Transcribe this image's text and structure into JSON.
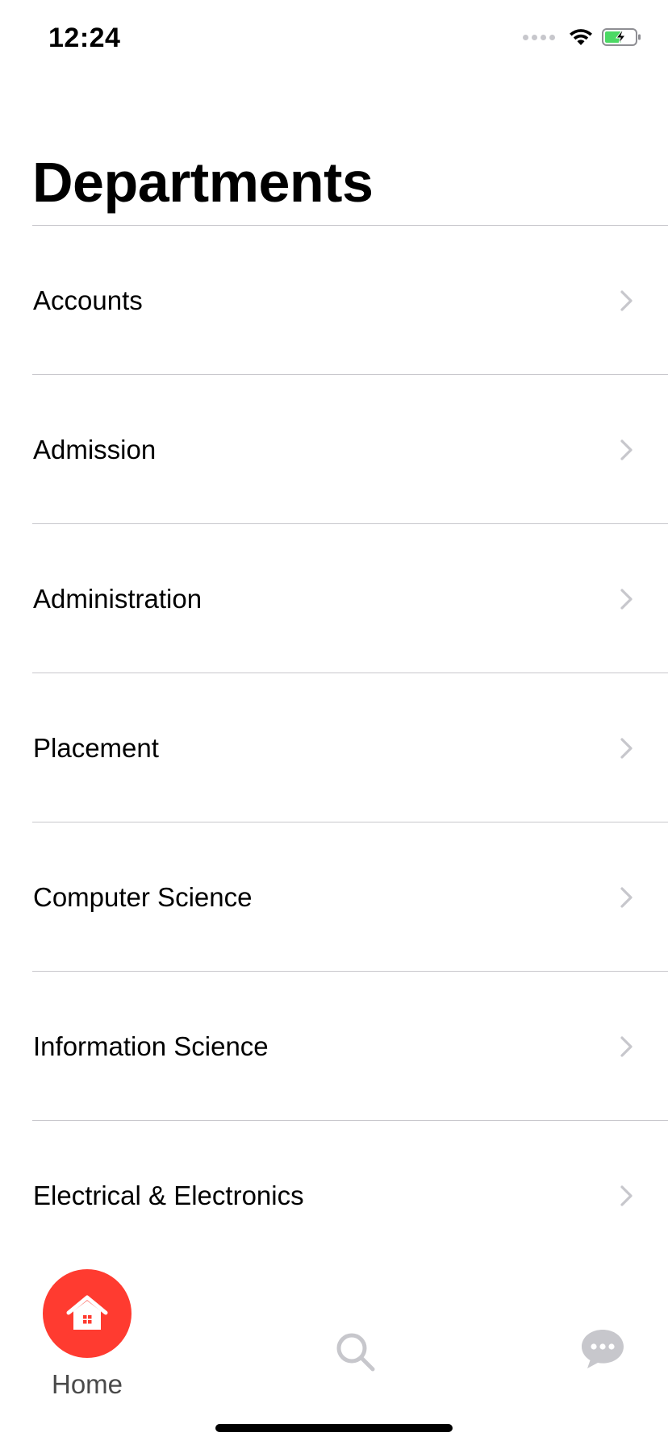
{
  "status_bar": {
    "time": "12:24"
  },
  "header": {
    "title": "Departments"
  },
  "departments": [
    {
      "label": "Accounts"
    },
    {
      "label": "Admission"
    },
    {
      "label": "Administration"
    },
    {
      "label": "Placement"
    },
    {
      "label": "Computer Science"
    },
    {
      "label": "Information Science"
    },
    {
      "label": "Electrical & Electronics"
    }
  ],
  "tab_bar": {
    "home_label": "Home",
    "home_icon": "home-icon",
    "search_icon": "search-icon",
    "chat_icon": "chat-bubble-icon",
    "accent_color": "#ff3b30",
    "inactive_color": "#c7c7cc"
  },
  "colors": {
    "battery_fill": "#4cd964",
    "divider": "#c8c7cc",
    "chevron": "#c7c7cc"
  }
}
